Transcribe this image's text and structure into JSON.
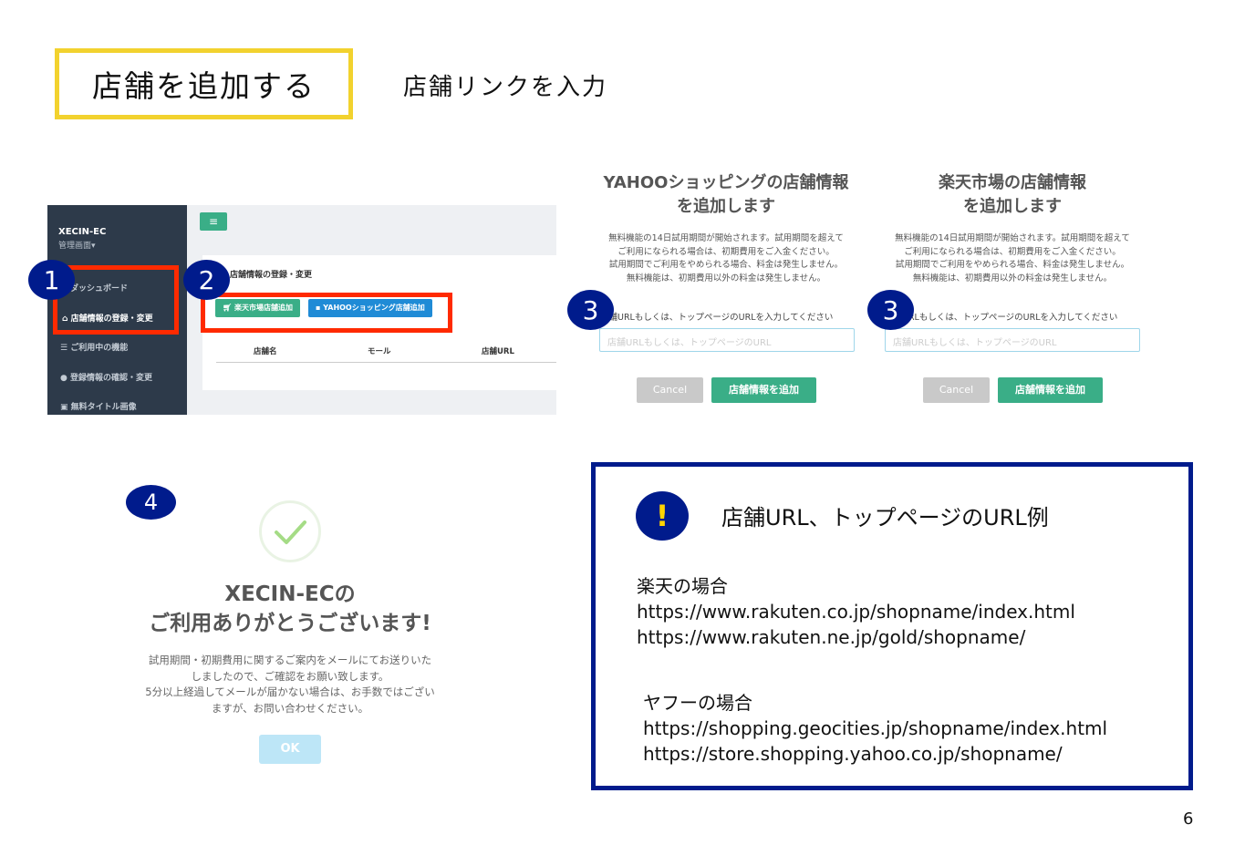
{
  "header": {
    "title": "店舗を追加する",
    "subtitle": "店舗リンクを入力"
  },
  "admin": {
    "brand": "XECIN-EC",
    "brand_sub": "管理画面▾",
    "menu_icon": "≡",
    "nav": [
      {
        "label": "ダッシュボード",
        "icon": "dashboard-icon"
      },
      {
        "label": "店舗情報の登録・変更",
        "icon": "home-icon"
      },
      {
        "label": "ご利用中の機能",
        "icon": "list-icon"
      },
      {
        "label": "登録情報の確認・変更",
        "icon": "user-icon"
      },
      {
        "label": "無料タイトル画像",
        "icon": "image-icon"
      }
    ],
    "panel_title": "店舗情報の登録・変更",
    "rakuten_button": "楽天市場店舗追加",
    "yahoo_button": "YAHOOショッピング店舗追加",
    "columns": [
      "店舗名",
      "モール",
      "店舗URL"
    ],
    "colors": {
      "sidebar": "#2d3a4a",
      "green": "#3aae87",
      "blue": "#1f8bd6",
      "highlight": "#ff2a00"
    }
  },
  "badges": {
    "one": "1",
    "two": "2",
    "three": "3",
    "four": "4",
    "excl": "!"
  },
  "yahoo_dialog": {
    "title_line1": "YAHOOショッピングの店舗情報",
    "title_line2": "を追加します",
    "note_lines": [
      "無料機能の14日試用期間が開始されます。試用期間を超えて",
      "ご利用になられる場合は、初期費用をご入金ください。",
      "試用期間でご利用をやめられる場合、料金は発生しません。",
      "無料機能は、初期費用以外の料金は発生しません。"
    ],
    "label": "店舗URLもしくは、トップページのURLを入力してください",
    "placeholder": "店舗URLもしくは、トップページのURL",
    "cancel": "Cancel",
    "submit": "店舗情報を追加"
  },
  "rakuten_dialog": {
    "title_line1": "楽天市場の店舗情報",
    "title_line2": "を追加します",
    "note_lines": [
      "無料機能の14日試用期間が開始されます。試用期間を超えて",
      "ご利用になられる場合は、初期費用をご入金ください。",
      "試用期間でご利用をやめられる場合、料金は発生しません。",
      "無料機能は、初期費用以外の料金は発生しません。"
    ],
    "label": "店舗URLもしくは、トップページのURLを入力してください",
    "placeholder": "店舗URLもしくは、トップページのURL",
    "cancel": "Cancel",
    "submit": "店舗情報を追加"
  },
  "thanks": {
    "title_line1": "XECIN-ECの",
    "title_line2": "ご利用ありがとうございます!",
    "body_lines": [
      "試用期間・初期費用に関するご案内をメールにてお送りいた",
      "しましたので、ご確認をお願い致します。",
      "5分以上経過してメールが届かない場合は、お手数ではござい",
      "ますが、お問い合わせください。"
    ],
    "ok": "OK"
  },
  "info": {
    "title": "店舗URL、トップページのURL例",
    "rakuten_heading": "楽天の場合",
    "rakuten_urls": [
      "https://www.rakuten.co.jp/shopname/index.html",
      "https://www.rakuten.ne.jp/gold/shopname/"
    ],
    "yahoo_heading": "ヤフーの場合",
    "yahoo_urls": [
      "https://shopping.geocities.jp/shopname/index.html",
      "https://store.shopping.yahoo.co.jp/shopname/"
    ]
  },
  "page_number": "6"
}
